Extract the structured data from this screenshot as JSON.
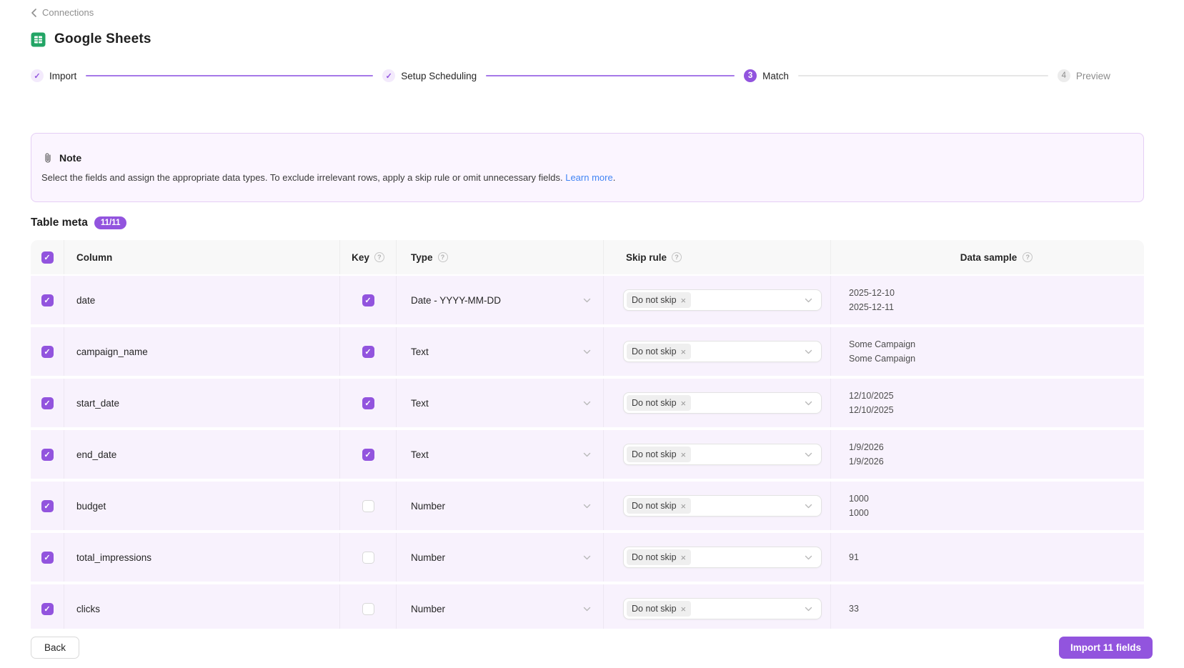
{
  "icons": {
    "check_glyph": "✓",
    "remove_glyph": "×",
    "help_glyph": "?"
  },
  "colors": {
    "accent": "#9254de",
    "sheets_green": "#23a566",
    "link_blue": "#4285f4",
    "row_bg": "#f8f2fd"
  },
  "breadcrumb": {
    "back_label": "Connections"
  },
  "header": {
    "title": "Google Sheets"
  },
  "stepper": {
    "steps": [
      {
        "label": "Import",
        "state": "done"
      },
      {
        "label": "Setup Scheduling",
        "state": "done"
      },
      {
        "label": "Match",
        "state": "active",
        "number": "3"
      },
      {
        "label": "Preview",
        "state": "pending",
        "number": "4"
      }
    ]
  },
  "note": {
    "title": "Note",
    "body": "Select the fields and assign the appropriate data types. To exclude irrelevant rows, apply a skip rule or omit unnecessary fields. ",
    "link_label": "Learn more",
    "link_suffix": "."
  },
  "section": {
    "title": "Table meta",
    "badge": "11/11"
  },
  "table": {
    "headers": {
      "column": "Column",
      "key": "Key",
      "type": "Type",
      "skip_rule": "Skip rule",
      "data_sample": "Data sample"
    },
    "rows": [
      {
        "column": "date",
        "selected": true,
        "key": true,
        "type": "Date - YYYY-MM-DD",
        "skip": "Do not skip",
        "samples": [
          "2025-12-10",
          "2025-12-11"
        ]
      },
      {
        "column": "campaign_name",
        "selected": true,
        "key": true,
        "type": "Text",
        "skip": "Do not skip",
        "samples": [
          "Some Campaign",
          "Some Campaign"
        ]
      },
      {
        "column": "start_date",
        "selected": true,
        "key": true,
        "type": "Text",
        "skip": "Do not skip",
        "samples": [
          "12/10/2025",
          "12/10/2025"
        ]
      },
      {
        "column": "end_date",
        "selected": true,
        "key": true,
        "type": "Text",
        "skip": "Do not skip",
        "samples": [
          "1/9/2026",
          "1/9/2026"
        ]
      },
      {
        "column": "budget",
        "selected": true,
        "key": false,
        "type": "Number",
        "skip": "Do not skip",
        "samples": [
          "1000",
          "1000"
        ]
      },
      {
        "column": "total_impressions",
        "selected": true,
        "key": false,
        "type": "Number",
        "skip": "Do not skip",
        "samples": [
          "91"
        ]
      },
      {
        "column": "clicks",
        "selected": true,
        "key": false,
        "type": "Number",
        "skip": "Do not skip",
        "samples": [
          "33"
        ]
      }
    ]
  },
  "footer": {
    "back_label": "Back",
    "import_label": "Import 11 fields"
  }
}
